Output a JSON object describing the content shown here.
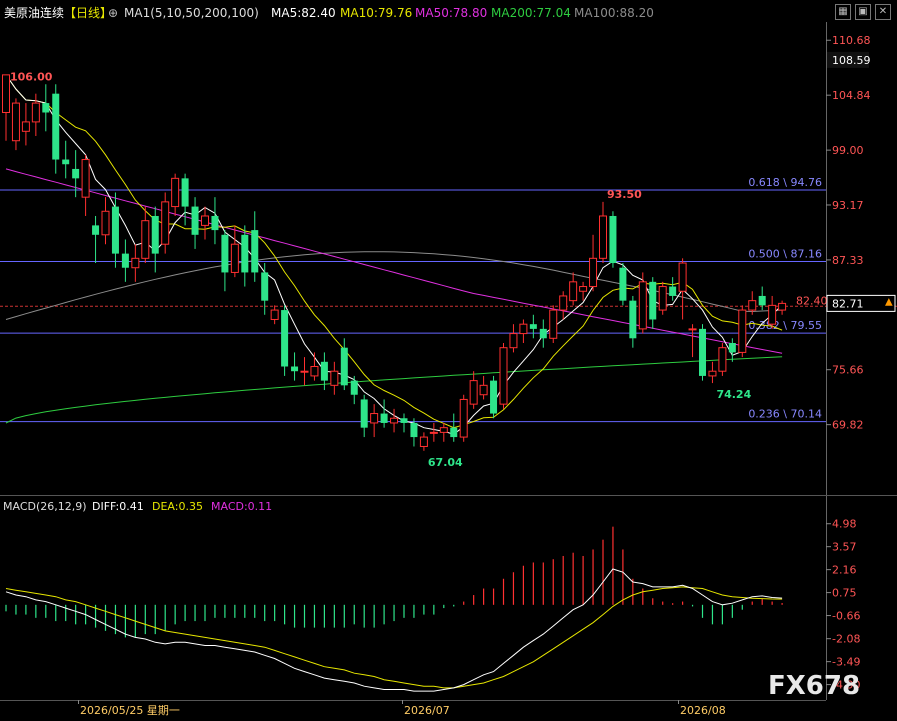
{
  "header": {
    "symbol": "美原油连续",
    "period": "【日线】",
    "settings_icon": "target-icon",
    "ma_params": "MA1(5,10,50,200,100)",
    "ma5": "MA5:82.40",
    "ma10": "MA10:79.76",
    "ma50": "MA50:78.80",
    "ma200": "MA200:77.04",
    "ma100": "MA100:88.20",
    "toolbar_icons": [
      "grid-icon",
      "restore-icon",
      "close-icon"
    ]
  },
  "colors": {
    "background": "#000000",
    "up": "#ff3030",
    "down": "#2ee58a",
    "ma5": "#ffffff",
    "ma10": "#e6e600",
    "ma50": "#e030e0",
    "ma200": "#2ecc40",
    "ma100": "#8c8c8c",
    "fib": "#6666ff",
    "diff": "#ffffff",
    "dea": "#e6e600",
    "macd": "#e030e0"
  },
  "chart_data": {
    "type": "candlestick",
    "y_ticks": [
      "110.68",
      "104.84",
      "99.00",
      "93.17",
      "87.33",
      "75.66",
      "69.82"
    ],
    "ylim": [
      65.0,
      112.3
    ],
    "current_price": "82.71",
    "highlight_price": "108.59",
    "last_close_label": "82.40",
    "candles": [
      [
        103.0,
        107.0,
        106.0,
        100.0
      ],
      [
        100.0,
        104.0,
        104.5,
        99.0
      ],
      [
        101.0,
        102.0,
        104.0,
        99.5
      ],
      [
        102.0,
        104.0,
        105.0,
        100.5
      ],
      [
        104.0,
        103.0,
        106.0,
        101.0
      ],
      [
        105.0,
        98.0,
        106.0,
        96.5
      ],
      [
        98.0,
        97.5,
        100.0,
        96.0
      ],
      [
        97.0,
        96.0,
        99.0,
        94.0
      ],
      [
        94.0,
        98.0,
        98.5,
        92.0
      ],
      [
        91.0,
        90.0,
        92.0,
        87.0
      ],
      [
        90.0,
        92.5,
        94.0,
        89.0
      ],
      [
        93.0,
        88.0,
        94.5,
        86.5
      ],
      [
        88.0,
        86.5,
        89.5,
        85.0
      ],
      [
        86.5,
        87.5,
        89.0,
        85.0
      ],
      [
        87.5,
        91.5,
        93.0,
        87.0
      ],
      [
        92.0,
        88.0,
        93.0,
        86.0
      ],
      [
        89.0,
        93.5,
        94.5,
        88.0
      ],
      [
        93.0,
        96.0,
        96.5,
        92.0
      ],
      [
        96.0,
        93.0,
        96.5,
        91.0
      ],
      [
        93.0,
        90.0,
        94.0,
        88.5
      ],
      [
        91.0,
        92.0,
        93.0,
        89.5
      ],
      [
        92.0,
        90.5,
        94.0,
        89.0
      ],
      [
        90.0,
        86.0,
        90.5,
        84.0
      ],
      [
        86.0,
        89.0,
        91.0,
        85.5
      ],
      [
        90.0,
        86.0,
        91.0,
        84.5
      ],
      [
        90.5,
        86.0,
        92.5,
        85.0
      ],
      [
        86.0,
        83.0,
        87.0,
        81.5
      ],
      [
        81.0,
        82.0,
        82.5,
        80.5
      ],
      [
        82.0,
        76.0,
        82.5,
        75.0
      ],
      [
        76.0,
        75.5,
        77.5,
        74.5
      ],
      [
        75.5,
        75.5,
        77.0,
        74.0
      ],
      [
        75.0,
        76.0,
        77.5,
        74.5
      ],
      [
        76.5,
        74.5,
        77.5,
        73.5
      ],
      [
        74.0,
        75.5,
        76.5,
        73.0
      ],
      [
        78.0,
        74.0,
        79.0,
        73.5
      ],
      [
        74.5,
        73.0,
        75.0,
        72.0
      ],
      [
        72.5,
        69.5,
        73.0,
        68.5
      ],
      [
        70.0,
        71.0,
        72.0,
        68.5
      ],
      [
        71.0,
        70.0,
        72.5,
        69.5
      ],
      [
        70.0,
        70.5,
        71.5,
        69.0
      ],
      [
        70.5,
        70.0,
        71.0,
        69.0
      ],
      [
        70.0,
        68.5,
        70.5,
        67.5
      ],
      [
        67.5,
        68.5,
        69.0,
        67.04
      ],
      [
        69.0,
        69.0,
        70.0,
        68.0
      ],
      [
        69.0,
        69.5,
        70.0,
        68.0
      ],
      [
        69.5,
        68.5,
        71.0,
        68.0
      ],
      [
        68.5,
        72.5,
        73.0,
        68.0
      ],
      [
        72.0,
        74.5,
        75.5,
        71.5
      ],
      [
        73.0,
        74.0,
        75.0,
        72.5
      ],
      [
        74.5,
        71.0,
        75.0,
        70.5
      ],
      [
        72.0,
        78.0,
        78.5,
        71.5
      ],
      [
        78.0,
        79.5,
        80.5,
        77.5
      ],
      [
        79.5,
        80.5,
        81.0,
        78.5
      ],
      [
        80.5,
        80.0,
        81.5,
        79.0
      ],
      [
        80.0,
        79.0,
        81.0,
        78.0
      ],
      [
        79.0,
        82.0,
        82.5,
        78.5
      ],
      [
        82.0,
        83.5,
        84.0,
        81.0
      ],
      [
        83.0,
        85.0,
        86.0,
        82.5
      ],
      [
        84.0,
        84.5,
        85.0,
        83.0
      ],
      [
        84.5,
        87.5,
        90.0,
        84.0
      ],
      [
        87.5,
        92.0,
        93.5,
        87.0
      ],
      [
        92.0,
        87.0,
        92.5,
        86.5
      ],
      [
        86.5,
        83.0,
        87.0,
        82.5
      ],
      [
        83.0,
        79.0,
        83.5,
        78.0
      ],
      [
        80.0,
        85.0,
        86.0,
        79.5
      ],
      [
        85.0,
        81.0,
        85.5,
        80.0
      ],
      [
        82.0,
        84.5,
        85.0,
        81.5
      ],
      [
        84.5,
        83.5,
        85.5,
        83.0
      ],
      [
        84.0,
        87.0,
        87.5,
        81.0
      ],
      [
        80.0,
        80.0,
        80.5,
        77.0
      ],
      [
        80.0,
        75.0,
        80.5,
        74.5
      ],
      [
        75.0,
        75.5,
        76.5,
        74.24
      ],
      [
        75.5,
        78.0,
        78.5,
        75.0
      ],
      [
        78.5,
        77.5,
        79.0,
        76.5
      ],
      [
        77.5,
        82.0,
        82.5,
        77.0
      ],
      [
        82.0,
        83.0,
        84.0,
        81.5
      ],
      [
        83.5,
        82.5,
        84.5,
        82.0
      ],
      [
        80.5,
        82.5,
        83.5,
        80.0
      ],
      [
        82.0,
        82.71,
        83.0,
        81.5
      ]
    ],
    "annotations": [
      {
        "text": "106.00",
        "index": 0,
        "price": 106.0
      },
      {
        "text": "93.50",
        "index": 60,
        "price": 93.5
      },
      {
        "text": "67.04",
        "index": 42,
        "price": 67.04
      },
      {
        "text": "74.24",
        "index": 71,
        "price": 74.24
      }
    ],
    "fib_levels": [
      {
        "value": 94.76,
        "label": "0.618 \\ 94.76"
      },
      {
        "value": 87.16,
        "label": "0.500 \\ 87.16"
      },
      {
        "value": 79.55,
        "label": "0.382 \\ 79.55"
      },
      {
        "value": 70.14,
        "label": "0.236 \\ 70.14"
      }
    ],
    "x_labels": [
      "2026/05/25 星期一",
      "2026/07",
      "2026/08"
    ],
    "macd": {
      "title": "MACD(26,12,9)",
      "diff_label": "DIFF:0.41",
      "dea_label": "DEA:0.35",
      "macd_label": "MACD:0.11",
      "y_ticks": [
        "4.98",
        "3.57",
        "2.16",
        "0.75",
        "-0.66",
        "-2.08",
        "-3.49",
        "-4.90"
      ],
      "ylim": [
        -5.6,
        5.7
      ],
      "diff": [
        0.8,
        0.6,
        0.5,
        0.3,
        0.2,
        0.0,
        -0.2,
        -0.4,
        -0.6,
        -0.9,
        -1.2,
        -1.5,
        -1.8,
        -2.0,
        -2.1,
        -2.3,
        -2.4,
        -2.3,
        -2.3,
        -2.4,
        -2.5,
        -2.5,
        -2.6,
        -2.7,
        -2.8,
        -2.9,
        -3.1,
        -3.3,
        -3.6,
        -3.9,
        -4.1,
        -4.3,
        -4.5,
        -4.6,
        -4.7,
        -4.8,
        -5.0,
        -5.1,
        -5.2,
        -5.2,
        -5.2,
        -5.3,
        -5.3,
        -5.3,
        -5.2,
        -5.1,
        -4.9,
        -4.6,
        -4.3,
        -4.1,
        -3.6,
        -3.1,
        -2.6,
        -2.2,
        -1.8,
        -1.3,
        -0.8,
        -0.3,
        0.0,
        0.6,
        1.4,
        2.2,
        2.0,
        1.4,
        1.3,
        1.1,
        1.1,
        1.1,
        1.2,
        1.0,
        0.6,
        0.2,
        0.0,
        0.1,
        0.3,
        0.5,
        0.55,
        0.45,
        0.41
      ],
      "dea": [
        1.0,
        0.9,
        0.8,
        0.7,
        0.6,
        0.5,
        0.3,
        0.2,
        0.0,
        -0.2,
        -0.4,
        -0.6,
        -0.8,
        -1.0,
        -1.2,
        -1.4,
        -1.6,
        -1.7,
        -1.8,
        -1.9,
        -2.0,
        -2.1,
        -2.2,
        -2.3,
        -2.4,
        -2.5,
        -2.6,
        -2.8,
        -3.0,
        -3.2,
        -3.4,
        -3.6,
        -3.8,
        -3.9,
        -4.0,
        -4.2,
        -4.3,
        -4.4,
        -4.6,
        -4.7,
        -4.8,
        -4.9,
        -5.0,
        -5.0,
        -5.1,
        -5.1,
        -5.0,
        -4.9,
        -4.8,
        -4.6,
        -4.4,
        -4.1,
        -3.8,
        -3.5,
        -3.1,
        -2.7,
        -2.3,
        -1.9,
        -1.5,
        -1.1,
        -0.6,
        -0.1,
        0.3,
        0.6,
        0.8,
        0.9,
        1.0,
        1.05,
        1.1,
        1.05,
        1.0,
        0.8,
        0.6,
        0.5,
        0.45,
        0.4,
        0.38,
        0.36,
        0.35
      ],
      "hist": [
        -0.4,
        -0.6,
        -0.6,
        -0.8,
        -0.8,
        -1.0,
        -1.0,
        -1.2,
        -1.2,
        -1.4,
        -1.6,
        -1.8,
        -2.0,
        -2.0,
        -1.8,
        -1.8,
        -1.6,
        -1.2,
        -1.0,
        -1.0,
        -1.0,
        -0.8,
        -0.8,
        -0.8,
        -0.8,
        -0.8,
        -1.0,
        -1.0,
        -1.2,
        -1.4,
        -1.4,
        -1.4,
        -1.4,
        -1.4,
        -1.4,
        -1.2,
        -1.4,
        -1.4,
        -1.2,
        -1.0,
        -0.8,
        -0.8,
        -0.6,
        -0.6,
        -0.2,
        -0.1,
        0.2,
        0.6,
        1.0,
        1.0,
        1.6,
        2.0,
        2.4,
        2.6,
        2.6,
        2.8,
        3.0,
        3.2,
        3.0,
        3.4,
        4.0,
        4.8,
        3.4,
        1.6,
        1.0,
        0.4,
        0.2,
        0.1,
        0.2,
        -0.1,
        -0.8,
        -1.2,
        -1.2,
        -0.8,
        -0.3,
        0.2,
        0.35,
        0.2,
        0.11
      ]
    }
  },
  "watermark": "FX678"
}
